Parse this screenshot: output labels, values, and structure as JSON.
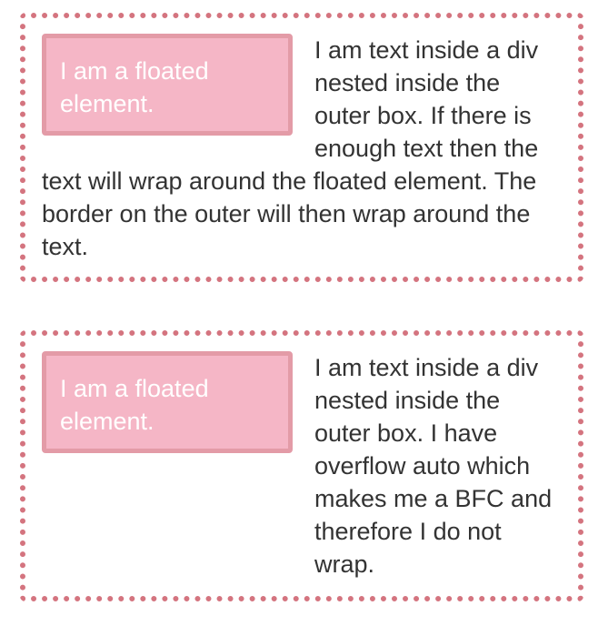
{
  "boxes": [
    {
      "floated_label": "I am a floated element.",
      "text": "I am text inside a div nested inside the outer box. If there is enough text then the text will wrap around the floated element. The border on the outer will then wrap around the text."
    },
    {
      "floated_label": "I am a floated element.",
      "text": "I am text inside a div nested inside the outer box. I have overflow auto which makes me a BFC and therefore I do not wrap."
    }
  ],
  "colors": {
    "outer_border": "#d4747f",
    "float_background": "#f5b6c6",
    "float_border": "#e39ba7",
    "float_text": "#ffffff",
    "body_text": "#333333"
  }
}
